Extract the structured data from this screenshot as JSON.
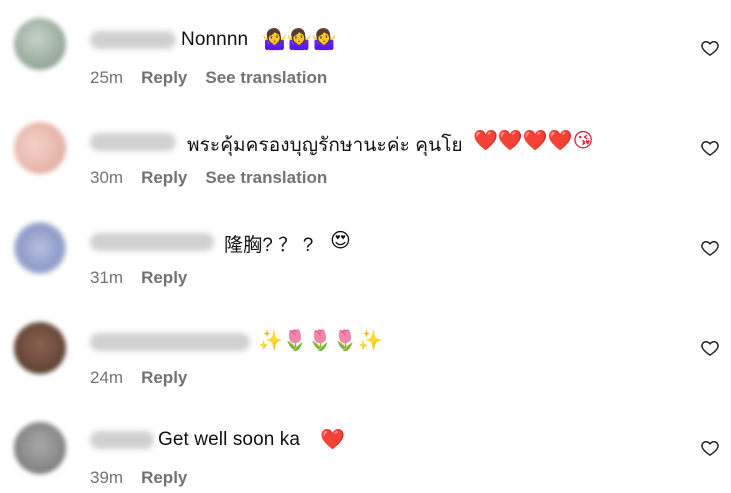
{
  "comments": [
    {
      "text": "Nonnnn",
      "emojis": "🤷‍♀️🤷‍♀️🤷‍♀️",
      "time": "25m",
      "reply_label": "Reply",
      "translation_label": "See translation",
      "avatar_color": "#9db0a2"
    },
    {
      "text": "พระคุ้มครองบุญรักษานะค่ะ คุนโย",
      "emojis": "❤️❤️❤️❤️😘",
      "time": "30m",
      "reply_label": "Reply",
      "translation_label": "See translation",
      "avatar_color": "#e8b9ad"
    },
    {
      "text": "隆胸? ？ ?",
      "emojis": "😍",
      "time": "31m",
      "reply_label": "Reply",
      "avatar_color": "#8f9cc8"
    },
    {
      "text": "",
      "emojis": "✨🌷🌷🌷✨",
      "time": "24m",
      "reply_label": "Reply",
      "avatar_color": "#6b4a3a"
    },
    {
      "text": "Get well soon ka",
      "emojis": "❤️",
      "time": "39m",
      "reply_label": "Reply",
      "avatar_color": "#8a8a8a"
    }
  ],
  "colors": {
    "meta_text": "#737373",
    "body_text": "#111111",
    "heart_outline": "#262626"
  }
}
